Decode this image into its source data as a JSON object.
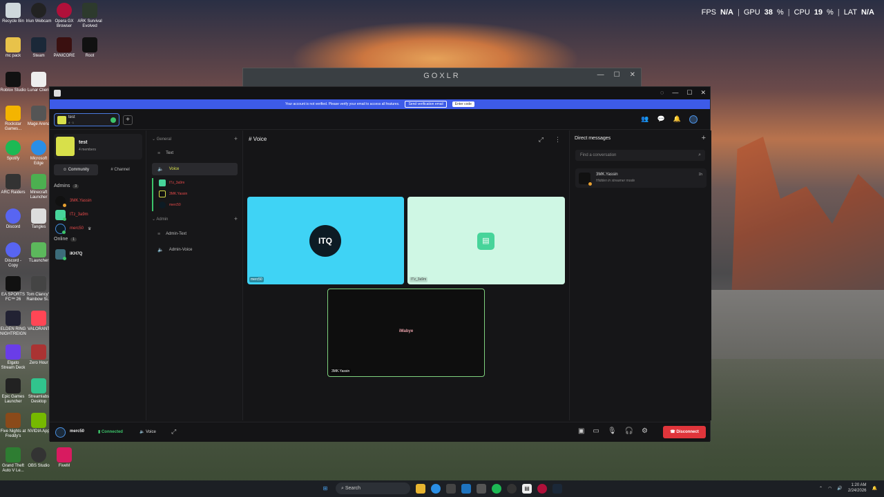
{
  "overlay": {
    "fps_label": "FPS",
    "fps_value": "N/A",
    "gpu_label": "GPU",
    "gpu_value": "38",
    "cpu_label": "CPU",
    "cpu_value": "19",
    "lat_label": "LAT",
    "lat_value": "N/A",
    "percent": "%"
  },
  "desktop_icons": [
    {
      "label": "Recycle Bin"
    },
    {
      "label": "Iriun Webcam"
    },
    {
      "label": "Opera GX Browser"
    },
    {
      "label": "ARK Survival Evolved"
    },
    {
      "label": "mc pack"
    },
    {
      "label": "Steam"
    },
    {
      "label": "PANICORE"
    },
    {
      "label": "Root"
    },
    {
      "label": "Roblox Studio"
    },
    {
      "label": "Lunar Client"
    },
    {
      "label": "Rockstar Games..."
    },
    {
      "label": "Mage Arena"
    },
    {
      "label": "Spotify"
    },
    {
      "label": "Microsoft Edge"
    },
    {
      "label": "ARC Raiders"
    },
    {
      "label": "Minecraft Launcher"
    },
    {
      "label": "Discord"
    },
    {
      "label": "Tangles"
    },
    {
      "label": "Discord - Copy"
    },
    {
      "label": "TLauncher"
    },
    {
      "label": "EA SPORTS FC™ 26"
    },
    {
      "label": "Tom Clancy's Rainbow Si..."
    },
    {
      "label": "ELDEN RING NIGHTREIGN"
    },
    {
      "label": "VALORANT"
    },
    {
      "label": "Elgato Stream Deck"
    },
    {
      "label": "Zero Hour"
    },
    {
      "label": "Epic Games Launcher"
    },
    {
      "label": "Streamlabs Desktop"
    },
    {
      "label": "Five Nights at Freddy's"
    },
    {
      "label": "NVIDIA App"
    },
    {
      "label": "Grand Theft Auto V Le..."
    },
    {
      "label": "OBS Studio"
    },
    {
      "label": "FiveM"
    }
  ],
  "goxlr": {
    "title": "GOXLR"
  },
  "app": {
    "banner": {
      "text": "Your account is not verified. Please verify your email to access all features.",
      "send_label": "Send verification email",
      "enter_label": "Enter code"
    },
    "server_chip": {
      "name": "test",
      "sub": "4  ·  1"
    },
    "server_card": {
      "name": "test",
      "members": "4 members"
    },
    "tabs": {
      "community": "Community",
      "channel": "Channel"
    },
    "admins": {
      "label": "Admins",
      "count": "3"
    },
    "online": {
      "label": "Online",
      "count": "1"
    },
    "members": [
      {
        "name": "3MK.Yassin"
      },
      {
        "name": "ITz_3a9m"
      },
      {
        "name": "merc50"
      },
      {
        "name": "iKH7Q"
      }
    ],
    "categories": {
      "general": "General",
      "admin": "Admin"
    },
    "channels": {
      "text": "Text",
      "voice": "Voice",
      "admin_text": "Admin-Text",
      "admin_voice": "Admin-Voice"
    },
    "voice_members": [
      {
        "name": "ITz_3a9m"
      },
      {
        "name": "3MK.Yassin"
      },
      {
        "name": "merc50"
      }
    ],
    "main": {
      "header": "# Voice",
      "tiles": [
        {
          "name": "merc50",
          "logo": "ITQ"
        },
        {
          "name": "ITz_3a9m"
        },
        {
          "name": "3MK.Yassin",
          "center": "iMabye"
        }
      ]
    },
    "dm": {
      "title": "Direct messages",
      "search_placeholder": "Find a conversation",
      "conversations": [
        {
          "name": "3MK.Yassin",
          "status": "Hidden in streamer mode",
          "time": "1h"
        }
      ]
    },
    "bottom": {
      "user": "merc50",
      "status": "Connected",
      "channel": "Voice",
      "disconnect": "Disconnect"
    }
  },
  "taskbar": {
    "search": "Search",
    "time": "1:20 AM",
    "date": "2/24/2026"
  },
  "colors": {
    "accent": "#3d5be8",
    "server": "#d8e04a",
    "online": "#3cc46a",
    "danger": "#e0353b"
  }
}
